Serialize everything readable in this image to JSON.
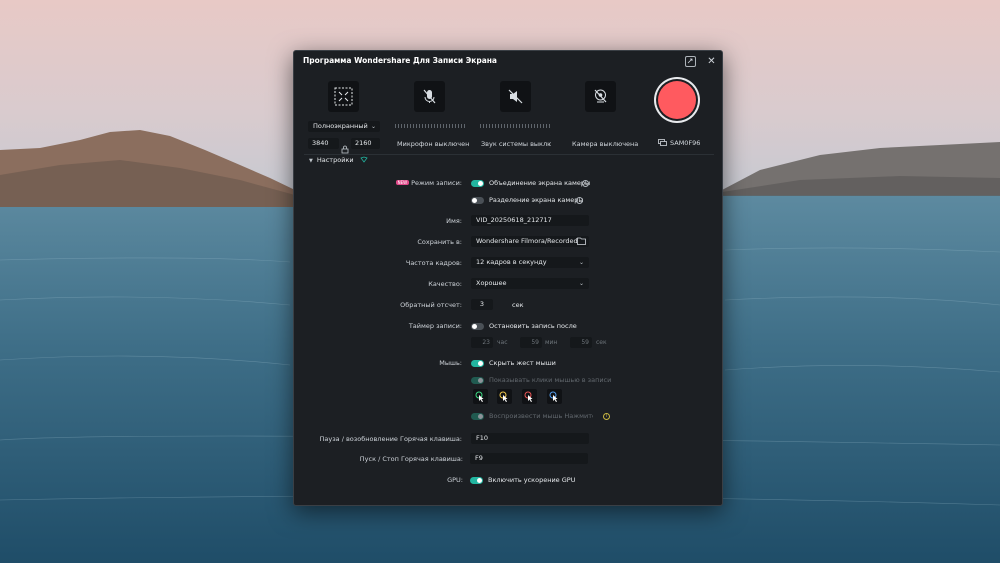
{
  "window": {
    "title": "Программа Wondershare Для Записи Экрана"
  },
  "sources": {
    "screen": {
      "mode": "Полноэкранный",
      "width": "3840",
      "height": "2160"
    },
    "mic": {
      "label": "Микрофон выключен"
    },
    "system_audio": {
      "label": "Звук системы выключен"
    },
    "camera": {
      "label": "Камера выключена"
    },
    "monitor": {
      "label": "SAM0F96"
    }
  },
  "settings": {
    "header": "Настройки",
    "record_mode": {
      "badge": "NEW",
      "label": "Режим записи:",
      "option1": "Объединение экрана камеры",
      "option2": "Разделение экрана камеры"
    },
    "name": {
      "label": "Имя:",
      "value": "VID_20250618_212717"
    },
    "save_to": {
      "label": "Сохранить в:",
      "value": "Wondershare Filmora/Recorded"
    },
    "frame_rate": {
      "label": "Частота кадров:",
      "value": "12 кадров в секунду"
    },
    "quality": {
      "label": "Качество:",
      "value": "Хорошее"
    },
    "countdown": {
      "label": "Обратный отсчет:",
      "value": "3",
      "unit": "сек"
    },
    "timer": {
      "label": "Таймер записи:",
      "option": "Остановить запись после",
      "hours": "23",
      "hours_unit": "час",
      "minutes": "59",
      "minutes_unit": "мин",
      "seconds": "59",
      "seconds_unit": "сек"
    },
    "mouse": {
      "label": "Мышь:",
      "hide_gesture": "Скрыть жест мыши",
      "show_clicks": "Показывать клики мышью в записи",
      "play_sound": "Воспроизвести мышь Нажмите звук"
    },
    "pause_hotkey": {
      "label": "Пауза / возобновление Горячая клавиша:",
      "value": "F10"
    },
    "start_hotkey": {
      "label": "Пуск / Стоп Горячая клавиша:",
      "value": "F9"
    },
    "gpu": {
      "label": "GPU:",
      "option": "Включить ускорение GPU"
    }
  },
  "colors": {
    "accent": "#22b5a0",
    "record": "#ff5a5f",
    "window_bg": "#1c1f23"
  }
}
